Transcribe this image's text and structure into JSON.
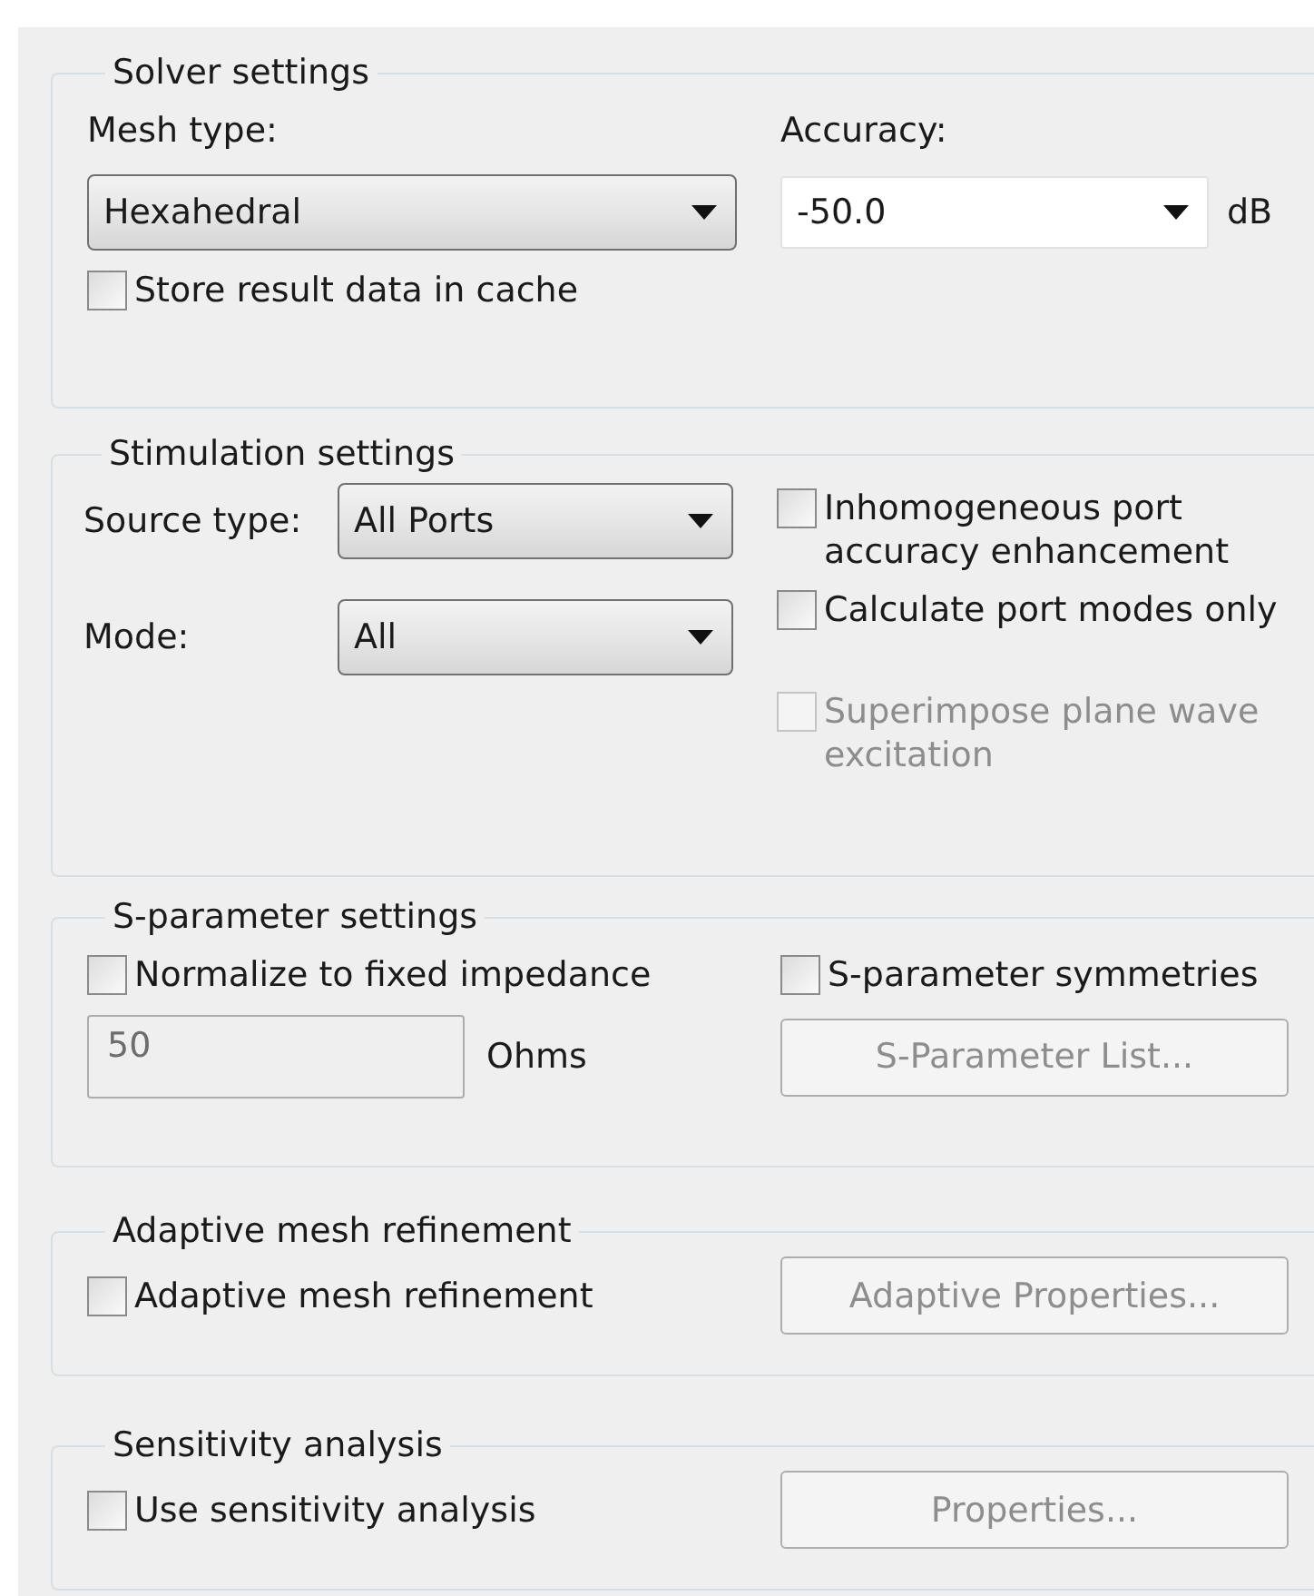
{
  "groups": [
    {
      "kind": "solver",
      "title": "Solver settings",
      "mesh_type": {
        "label": "Mesh type:",
        "value": "Hexahedral",
        "editable": false
      },
      "accuracy": {
        "label": "Accuracy:",
        "value": "-50.0",
        "unit": "dB",
        "editable": true
      },
      "checkbox": {
        "label": "Store result data in cache",
        "checked": false,
        "disabled": false
      }
    },
    {
      "kind": "stimulation",
      "title": "Stimulation settings",
      "source_type": {
        "label": "Source type:",
        "value": "All Ports",
        "editable": false
      },
      "mode": {
        "label": "Mode:",
        "value": "All",
        "editable": false
      },
      "checkboxes": [
        {
          "label": "Inhomogeneous port accuracy enhancement",
          "checked": false,
          "disabled": false
        },
        {
          "label": "Calculate port modes only",
          "checked": false,
          "disabled": false
        },
        {
          "label": "Superimpose plane wave excitation",
          "checked": false,
          "disabled": true
        }
      ]
    },
    {
      "kind": "sparameter",
      "title": "S-parameter settings",
      "checkboxes": [
        {
          "label": "Normalize to fixed impedance",
          "checked": false,
          "disabled": false
        },
        {
          "label": "S-parameter symmetries",
          "checked": false,
          "disabled": false
        }
      ],
      "impedance": {
        "value": "50",
        "unit": "Ohms",
        "disabled": true
      },
      "button": {
        "label": "S-Parameter List...",
        "disabled": true
      }
    },
    {
      "kind": "option",
      "title": "Adaptive mesh refinement",
      "checkbox": {
        "label": "Adaptive mesh refinement",
        "checked": false,
        "disabled": false
      },
      "button": {
        "label": "Adaptive Properties...",
        "disabled": true
      }
    },
    {
      "kind": "option",
      "title": "Sensitivity analysis",
      "checkbox": {
        "label": "Use sensitivity analysis",
        "checked": false,
        "disabled": false
      },
      "button": {
        "label": "Properties...",
        "disabled": true
      }
    }
  ]
}
